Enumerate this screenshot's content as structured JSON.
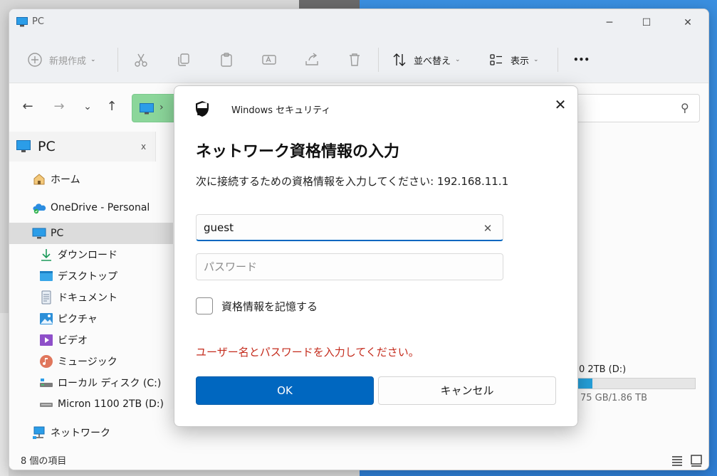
{
  "window": {
    "title": "PC"
  },
  "toolbar": {
    "new_label": "新規作成",
    "sort_label": "並べ替え",
    "view_label": "表示",
    "more_label": "•••"
  },
  "sidebar": {
    "header": "PC",
    "header_close": "x",
    "items": [
      {
        "label": "ホーム",
        "icon": "home-icon"
      },
      {
        "label": "OneDrive - Personal",
        "icon": "onedrive-icon"
      },
      {
        "label": "PC",
        "icon": "pc-icon"
      },
      {
        "label": "ダウンロード",
        "icon": "download-icon"
      },
      {
        "label": "デスクトップ",
        "icon": "desktop-icon"
      },
      {
        "label": "ドキュメント",
        "icon": "document-icon"
      },
      {
        "label": "ピクチャ",
        "icon": "picture-icon"
      },
      {
        "label": "ビデオ",
        "icon": "video-icon"
      },
      {
        "label": "ミュージック",
        "icon": "music-icon"
      },
      {
        "label": "ローカル ディスク (C:)",
        "icon": "drive-icon"
      },
      {
        "label": "Micron 1100 2TB (D:)",
        "icon": "drive-icon"
      },
      {
        "label": "ネットワーク",
        "icon": "network-icon"
      }
    ]
  },
  "drive_card": {
    "name": "0 2TB (D:)",
    "size": "75 GB/1.86 TB",
    "used_fraction": 0.21
  },
  "status": {
    "count": "8 個の項目"
  },
  "dialog": {
    "app_name": "Windows セキュリティ",
    "close": "✕",
    "title": "ネットワーク資格情報の入力",
    "description": "次に接続するための資格情報を入力してください: 192.168.11.1",
    "username_value": "guest",
    "password_placeholder": "パスワード",
    "clear": "✕",
    "remember_label": "資格情報を記憶する",
    "error": "ユーザー名とパスワードを入力してください。",
    "ok_label": "OK",
    "cancel_label": "キャンセル"
  },
  "colors": {
    "accent": "#0067c0",
    "error": "#c42b1c",
    "address_highlight": "#8bd69a"
  }
}
